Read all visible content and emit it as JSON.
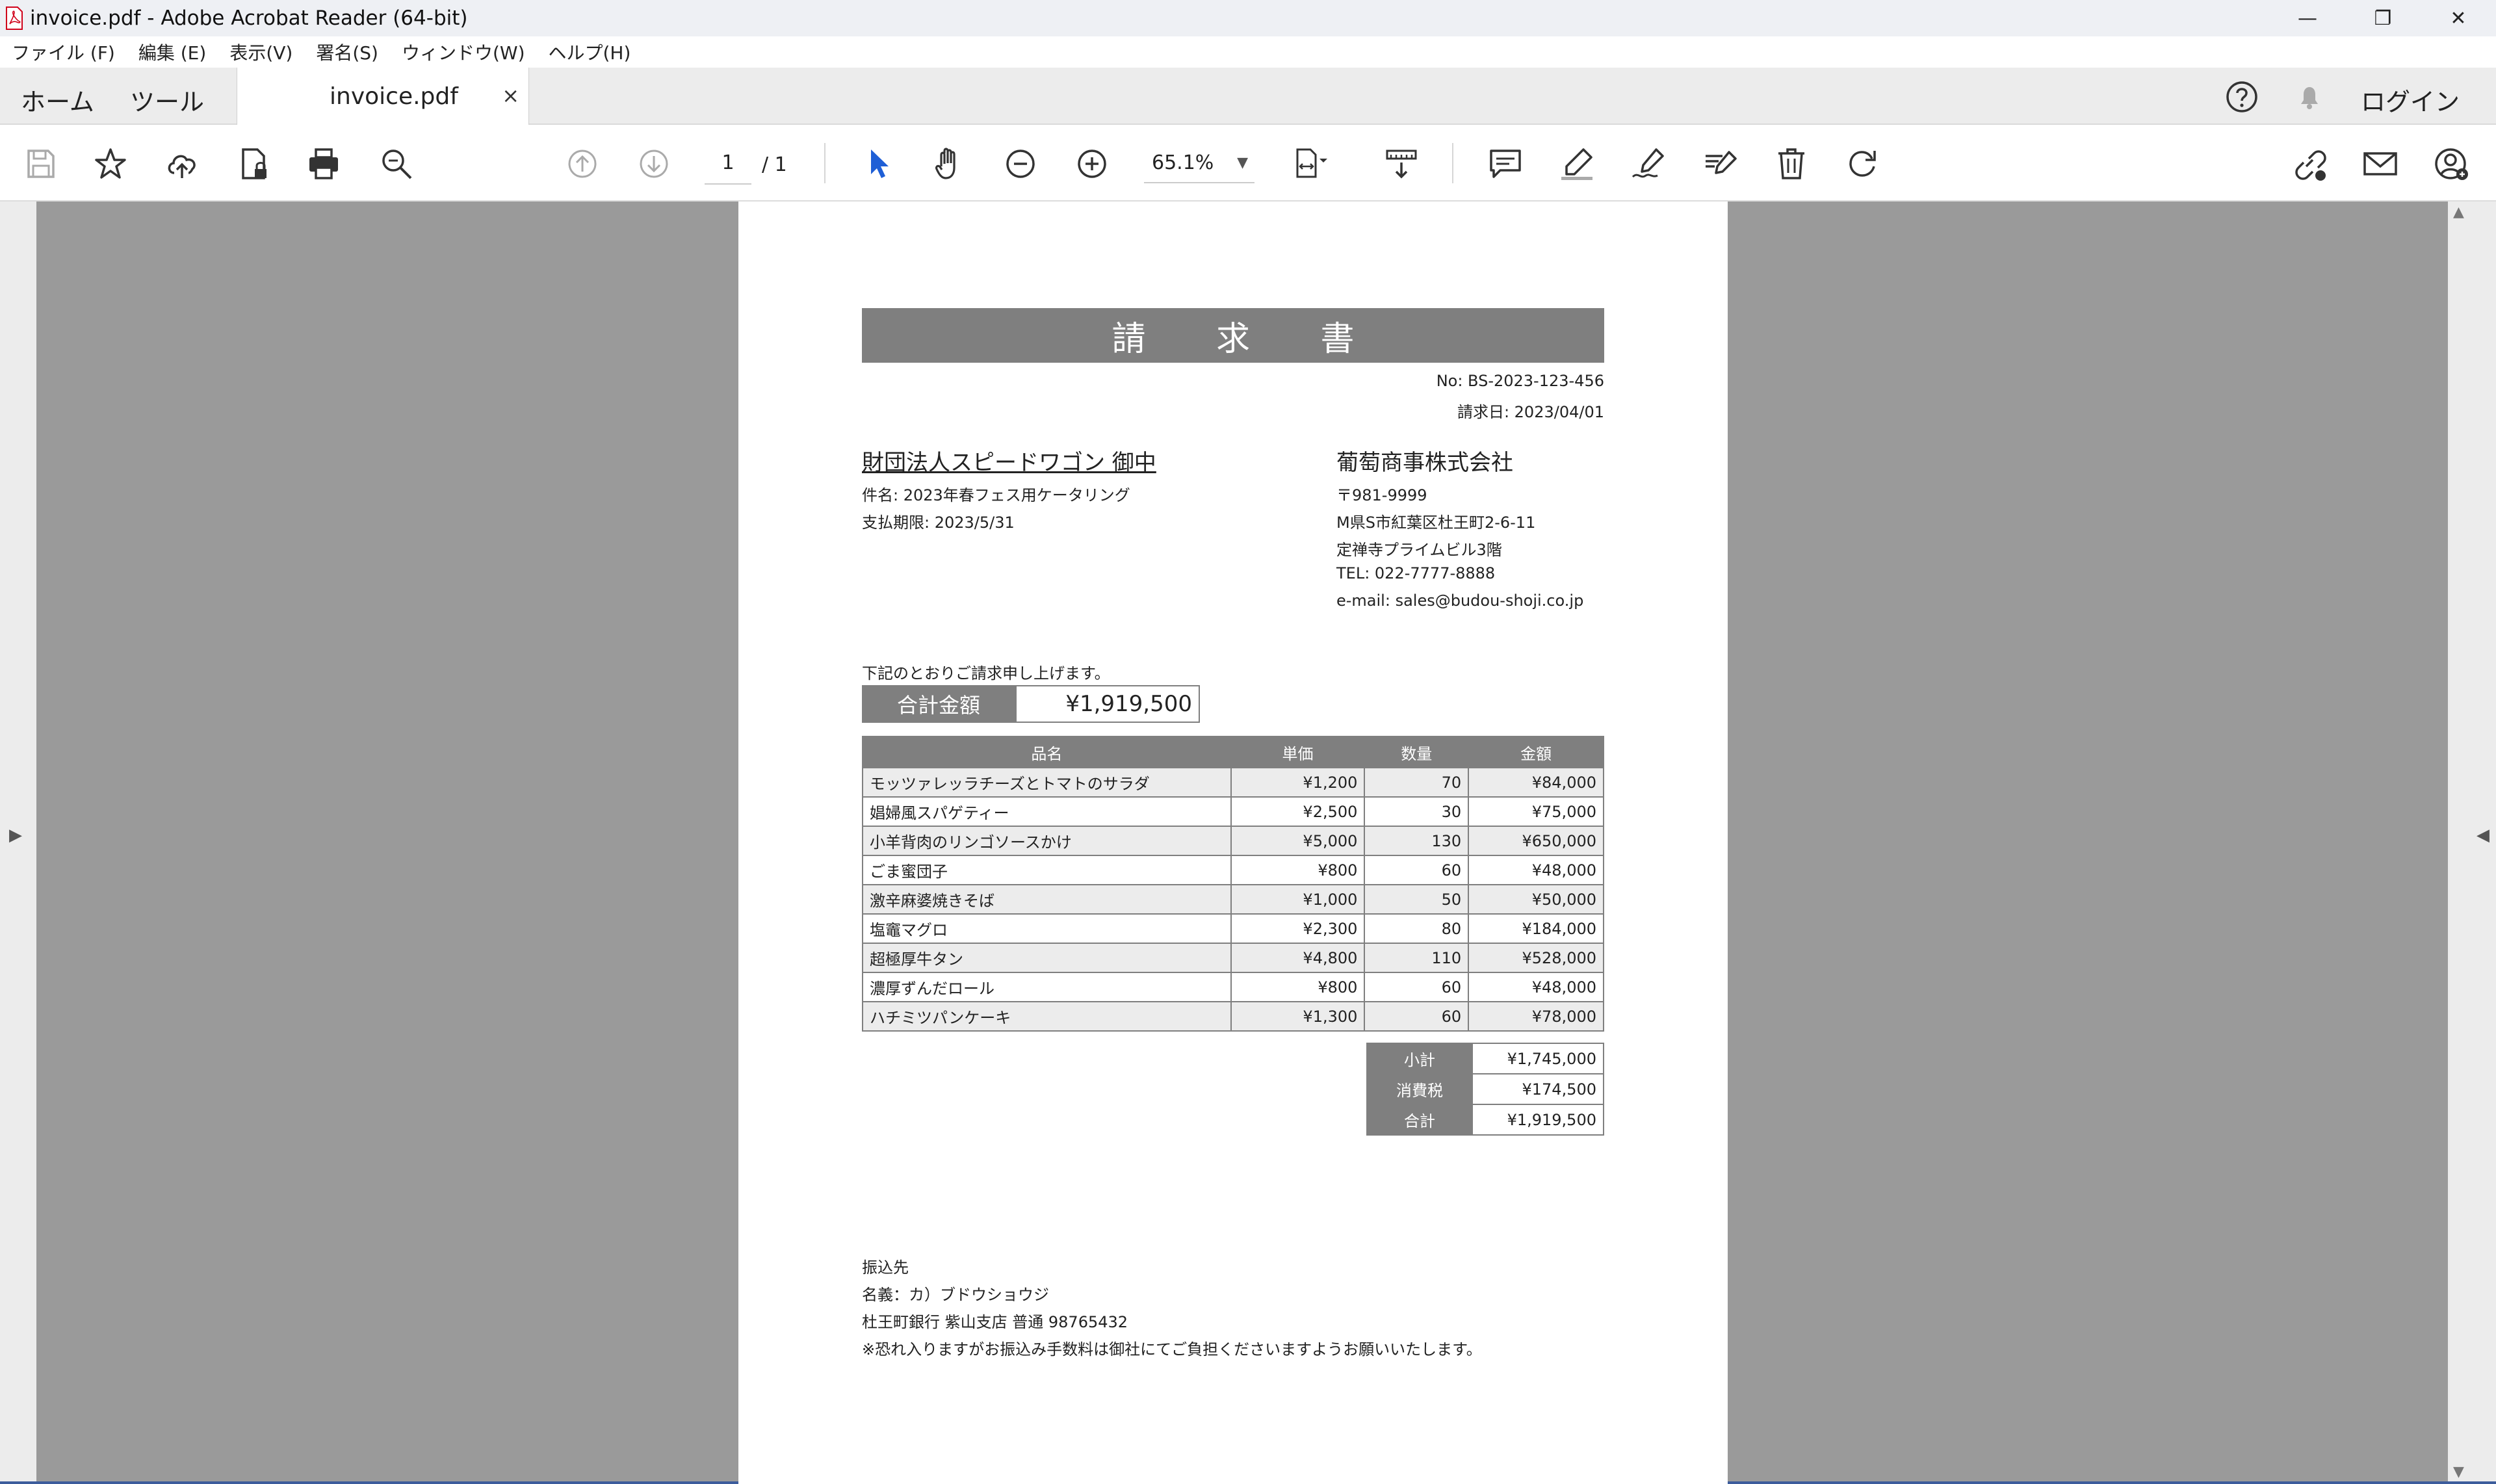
{
  "window": {
    "title": "invoice.pdf - Adobe Acrobat Reader (64-bit)",
    "controls": [
      "—",
      "❐",
      "✕"
    ]
  },
  "menu": [
    "ファイル (F)",
    "編集 (E)",
    "表示(V)",
    "署名(S)",
    "ウィンドウ(W)",
    "ヘルプ(H)"
  ],
  "tabs": {
    "home": "ホーム",
    "tools": "ツール",
    "document": "invoice.pdf",
    "close": "×",
    "login": "ログイン"
  },
  "toolbar": {
    "page_current": "1",
    "page_total": "/ 1",
    "zoom": "65.1%"
  },
  "invoice": {
    "title": "請 求 書",
    "number": "No: BS-2023-123-456",
    "date": "請求日: 2023/04/01",
    "client": "財団法人スピードワゴン 御中",
    "subject": "件名: 2023年春フェス用ケータリング",
    "due": "支払期限: 2023/5/31",
    "company": {
      "name": "葡萄商事株式会社",
      "postal": "〒981-9999",
      "address1": "M県S市紅葉区杜王町2-6-11",
      "address2": "定禅寺プライムビル3階",
      "tel": "TEL: 022-7777-8888",
      "email": "e-mail: sales@budou-shoji.co.jp"
    },
    "intro": "下記のとおりご請求申し上げます。",
    "total_label": "合計金額",
    "total_value": "¥1,919,500",
    "columns": [
      "品名",
      "単価",
      "数量",
      "金額"
    ],
    "items": [
      {
        "name": "モッツァレッラチーズとトマトのサラダ",
        "price": "¥1,200",
        "qty": "70",
        "amount": "¥84,000"
      },
      {
        "name": "娼婦風スパゲティー",
        "price": "¥2,500",
        "qty": "30",
        "amount": "¥75,000"
      },
      {
        "name": "小羊背肉のリンゴソースかけ",
        "price": "¥5,000",
        "qty": "130",
        "amount": "¥650,000"
      },
      {
        "name": "ごま蜜団子",
        "price": "¥800",
        "qty": "60",
        "amount": "¥48,000"
      },
      {
        "name": "激辛麻婆焼きそば",
        "price": "¥1,000",
        "qty": "50",
        "amount": "¥50,000"
      },
      {
        "name": "塩竈マグロ",
        "price": "¥2,300",
        "qty": "80",
        "amount": "¥184,000"
      },
      {
        "name": "超極厚牛タン",
        "price": "¥4,800",
        "qty": "110",
        "amount": "¥528,000"
      },
      {
        "name": "濃厚ずんだロール",
        "price": "¥800",
        "qty": "60",
        "amount": "¥48,000"
      },
      {
        "name": "ハチミツパンケーキ",
        "price": "¥1,300",
        "qty": "60",
        "amount": "¥78,000"
      }
    ],
    "summary": [
      {
        "label": "小計",
        "value": "¥1,745,000"
      },
      {
        "label": "消費税",
        "value": "¥174,500"
      },
      {
        "label": "合計",
        "value": "¥1,919,500"
      }
    ],
    "bank": {
      "heading": "振込先",
      "holder": "名義：カ）ブドウショウジ",
      "account": "杜王町銀行 紫山支店 普通 98765432",
      "note": "※恐れ入りますがお振込み手数料は御社にてご負担くださいますようお願いいたします。"
    }
  },
  "colors": {
    "header_gray": "#7f7f7f",
    "row_alt": "#ececec",
    "workspace": "#9a9a9a",
    "select_blue": "#1f5fd6"
  }
}
